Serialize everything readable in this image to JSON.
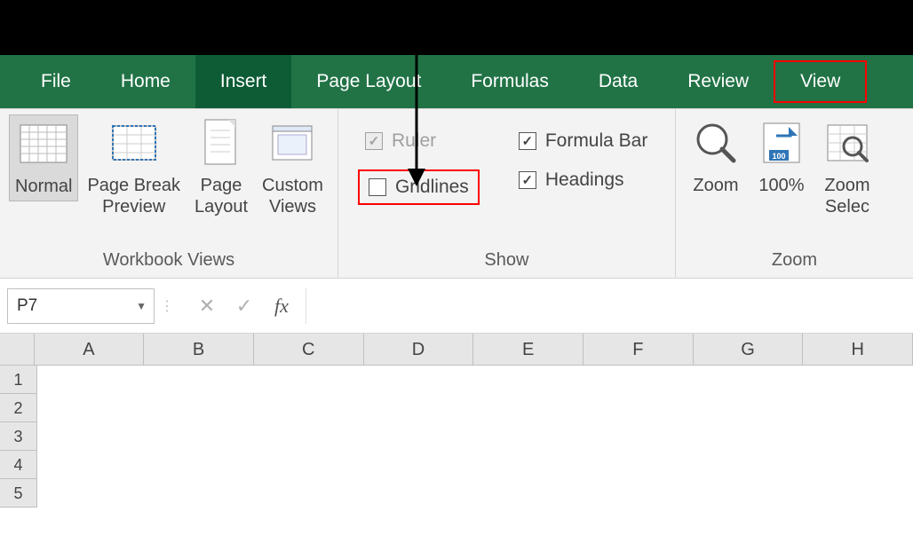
{
  "tabs": [
    "File",
    "Home",
    "Insert",
    "Page Layout",
    "Formulas",
    "Data",
    "Review",
    "View"
  ],
  "active_tab_idx": 2,
  "highlighted_tab_idx": 7,
  "workbook_views": {
    "group_label": "Workbook Views",
    "normal": "Normal",
    "page_break": "Page Break\nPreview",
    "page_layout": "Page\nLayout",
    "custom_views": "Custom\nViews"
  },
  "show": {
    "group_label": "Show",
    "ruler": "Ruler",
    "gridlines": "Gridlines",
    "formula_bar": "Formula Bar",
    "headings": "Headings",
    "ruler_checked": true,
    "ruler_disabled": true,
    "gridlines_checked": false,
    "formula_bar_checked": true,
    "headings_checked": true
  },
  "zoom": {
    "group_label": "Zoom",
    "zoom": "Zoom",
    "pct100": "100%",
    "zoom_sel": "Zoom\nSelec"
  },
  "namebox": "P7",
  "fx_label": "fx",
  "columns": [
    "A",
    "B",
    "C",
    "D",
    "E",
    "F",
    "G",
    "H"
  ],
  "rows": [
    "1",
    "2",
    "3",
    "4",
    "5"
  ]
}
